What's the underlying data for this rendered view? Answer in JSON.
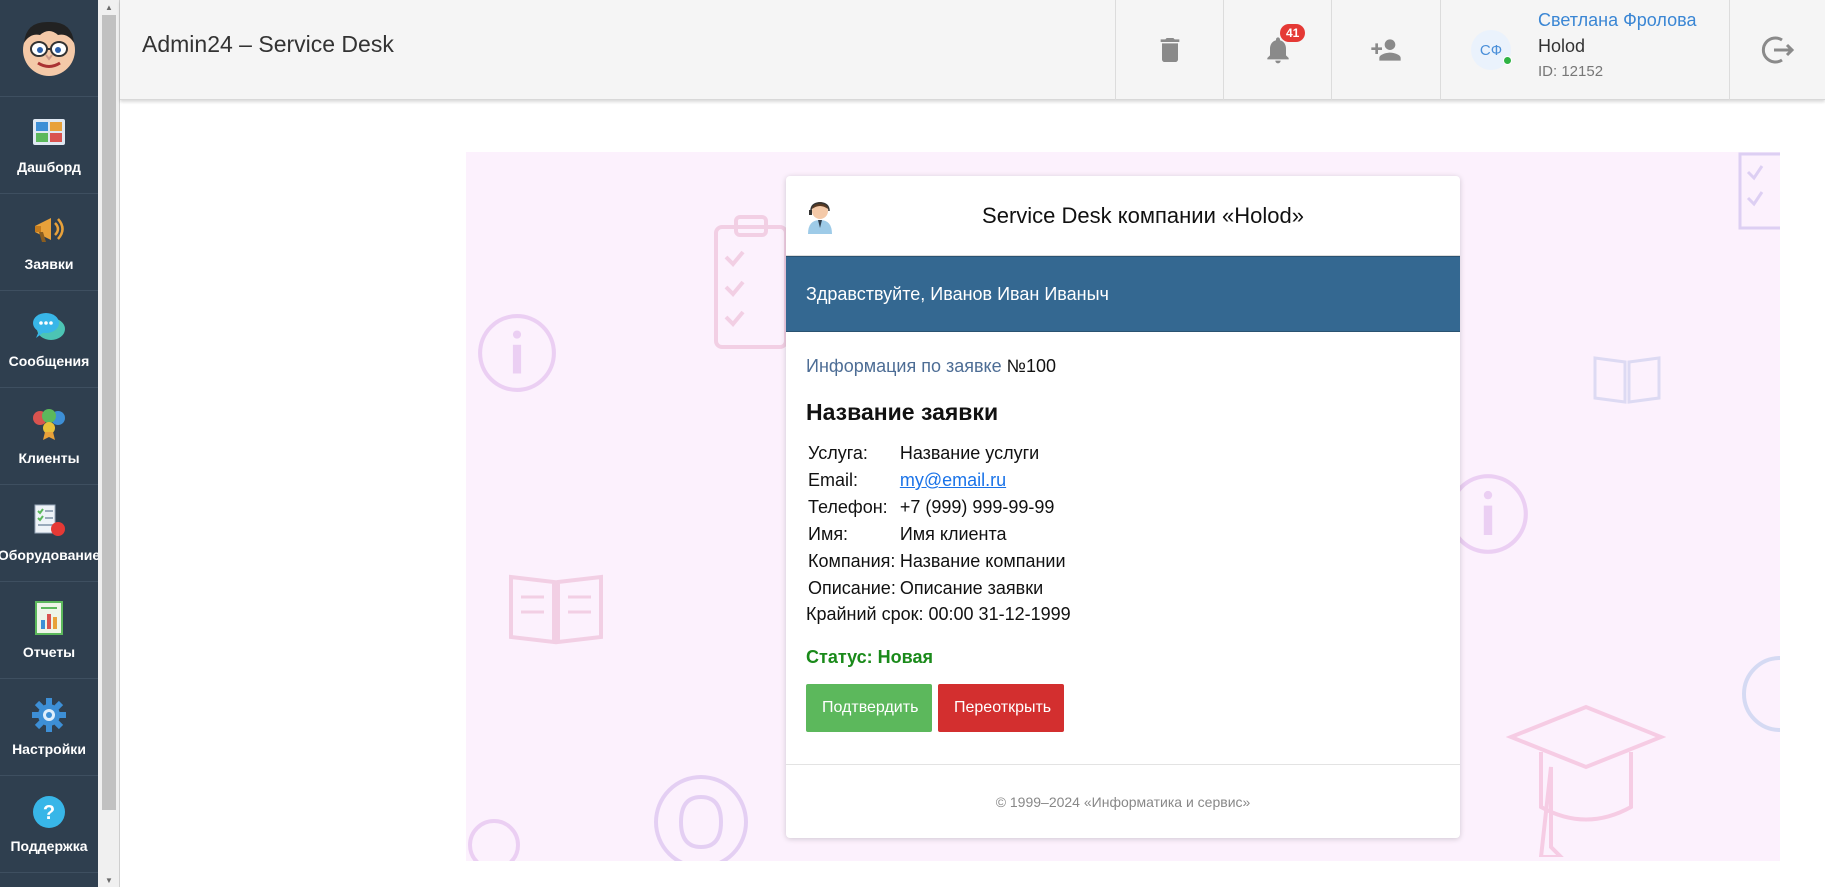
{
  "sidebar": {
    "items": [
      {
        "label": "Дашборд",
        "icon": "dashboard-icon"
      },
      {
        "label": "Заявки",
        "icon": "megaphone-icon"
      },
      {
        "label": "Сообщения",
        "icon": "chat-bubble-icon"
      },
      {
        "label": "Клиенты",
        "icon": "clients-icon"
      },
      {
        "label": "Оборудование",
        "icon": "equipment-icon"
      },
      {
        "label": "Отчеты",
        "icon": "report-icon"
      },
      {
        "label": "Настройки",
        "icon": "gear-icon"
      },
      {
        "label": "Поддержка",
        "icon": "help-icon"
      }
    ]
  },
  "header": {
    "title": "Admin24 – Service Desk",
    "notifications_count": "41",
    "user": {
      "initials": "СФ",
      "name": "Светлана Фролова",
      "company": "Holod",
      "id": "ID: 12152"
    }
  },
  "card": {
    "title": "Service Desk компании «Holod»",
    "greeting": "Здравствуйте, Иванов Иван Иваныч",
    "info_prefix": "Информация по заявке",
    "info_number": "№100",
    "request_title": "Название заявки",
    "details": [
      {
        "label": "Услуга:",
        "value": "Название услуги"
      },
      {
        "label": "Email:",
        "value": "my@email.ru"
      },
      {
        "label": "Телефон:",
        "value": "+7 (999) 999-99-99"
      },
      {
        "label": "Имя:",
        "value": "Имя клиента"
      },
      {
        "label": "Компания:",
        "value": "Название компании"
      },
      {
        "label": "Описание:",
        "value": "Описание заявки"
      }
    ],
    "deadline": "Крайний срок: 00:00 31-12-1999",
    "status": "Статус: Новая",
    "confirm_label": "Подтвердить",
    "reopen_label": "Переоткрыть",
    "footer": "© 1999–2024 «Информатика и сервис»"
  },
  "colors": {
    "sidebar_bg": "#2f3f4f",
    "greeting_bar": "#346891",
    "confirm": "#5cb85c",
    "reopen": "#d32f2f",
    "status": "#1a8a1a",
    "badge": "#e53935"
  }
}
